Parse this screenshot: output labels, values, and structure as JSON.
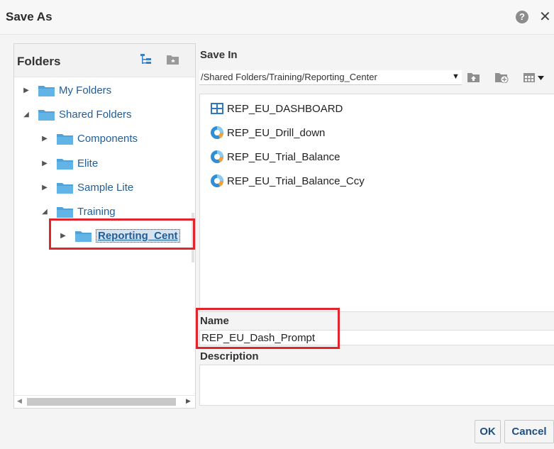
{
  "dialog": {
    "title": "Save As",
    "help_icon": "help-icon",
    "close_icon": "close-icon"
  },
  "folders_panel": {
    "title": "Folders",
    "header_icons": [
      "tree-view-icon",
      "new-folder-icon"
    ],
    "tree": [
      {
        "label": "My Folders",
        "expanded": false,
        "selected": false
      },
      {
        "label": "Shared Folders",
        "expanded": true,
        "selected": false
      },
      {
        "label": "Components",
        "expanded": false,
        "selected": false
      },
      {
        "label": "Elite",
        "expanded": false,
        "selected": false
      },
      {
        "label": "Sample Lite",
        "expanded": false,
        "selected": false
      },
      {
        "label": "Training",
        "expanded": true,
        "selected": false
      },
      {
        "label": "Reporting_Cent",
        "expanded": false,
        "selected": true
      }
    ]
  },
  "save_in": {
    "label": "Save In",
    "path": "/Shared Folders/Training/Reporting_Center",
    "tool_icons": [
      "up-folder-icon",
      "new-folder-icon",
      "view-options-icon"
    ]
  },
  "files": [
    {
      "name": "REP_EU_DASHBOARD",
      "icon": "dashboard-icon"
    },
    {
      "name": "REP_EU_Drill_down",
      "icon": "analysis-icon"
    },
    {
      "name": "REP_EU_Trial_Balance",
      "icon": "analysis-icon"
    },
    {
      "name": "REP_EU_Trial_Balance_Ccy",
      "icon": "analysis-icon"
    }
  ],
  "name_field": {
    "label": "Name",
    "value": "REP_EU_Dash_Prompt"
  },
  "description_field": {
    "label": "Description",
    "value": ""
  },
  "buttons": {
    "ok": "OK",
    "cancel": "Cancel"
  },
  "colors": {
    "highlight": "#e0252c",
    "link": "#1f5e99",
    "folder": "#4fa3d9"
  }
}
